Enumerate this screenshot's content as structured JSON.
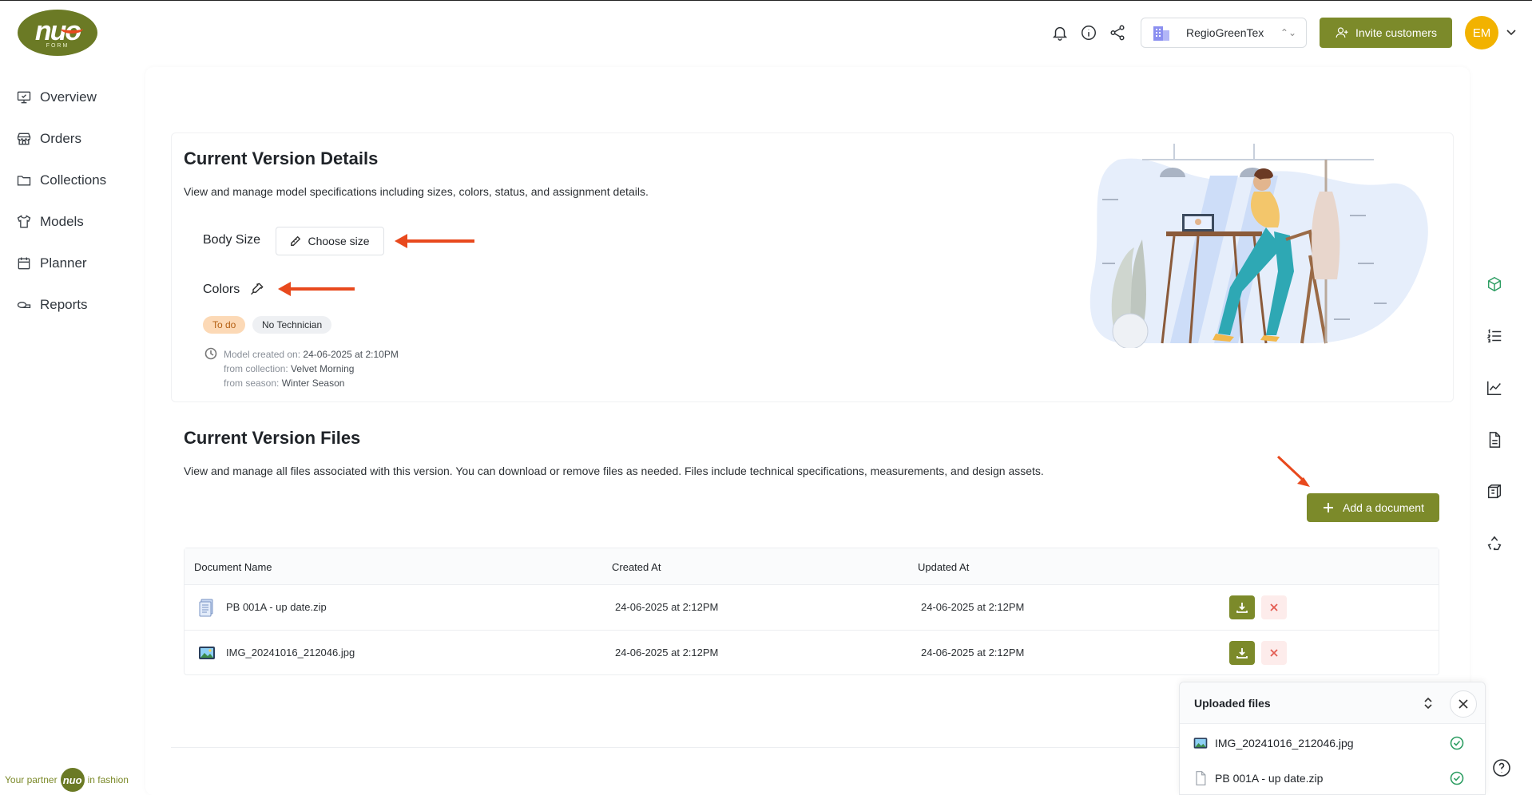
{
  "brand": {
    "logo_text": "nuo",
    "logo_sub": "FORM",
    "partner_prefix": "Your partner",
    "partner_suffix": "in fashion"
  },
  "sidebar": {
    "items": [
      {
        "label": "Overview",
        "icon": "monitor-icon"
      },
      {
        "label": "Orders",
        "icon": "store-icon"
      },
      {
        "label": "Collections",
        "icon": "folder-icon"
      },
      {
        "label": "Models",
        "icon": "shirt-icon"
      },
      {
        "label": "Planner",
        "icon": "calendar-icon"
      },
      {
        "label": "Reports",
        "icon": "tape-icon"
      }
    ]
  },
  "header": {
    "company": "RegioGreenTex",
    "invite_label": "Invite customers",
    "avatar_initials": "EM"
  },
  "details": {
    "title": "Current Version Details",
    "description": "View and manage model specifications including sizes, colors, status, and assignment details.",
    "body_size_label": "Body Size",
    "choose_size_label": "Choose size",
    "colors_label": "Colors",
    "status_badge": "To do",
    "technician_badge": "No Technician",
    "created_label": "Model created on:",
    "created_value": "24-06-2025 at 2:10PM",
    "collection_label": "from collection:",
    "collection_value": "Velvet Morning",
    "season_label": "from season:",
    "season_value": "Winter Season"
  },
  "files": {
    "title": "Current Version Files",
    "description": "View and manage all files associated with this version. You can download or remove files as needed. Files include technical specifications, measurements, and design assets.",
    "add_label": "Add a document",
    "columns": [
      "Document Name",
      "Created At",
      "Updated At"
    ],
    "rows": [
      {
        "name": "PB 001A - up date.zip",
        "created": "24-06-2025 at 2:12PM",
        "updated": "24-06-2025 at 2:12PM",
        "icon": "zip-file-icon"
      },
      {
        "name": "IMG_20241016_212046.jpg",
        "created": "24-06-2025 at 2:12PM",
        "updated": "24-06-2025 at 2:12PM",
        "icon": "image-file-icon"
      }
    ]
  },
  "uploads": {
    "title": "Uploaded files",
    "items": [
      {
        "name": "IMG_20241016_212046.jpg",
        "icon": "image-file-icon"
      },
      {
        "name": "PB 001A - up date.zip",
        "icon": "file-icon"
      }
    ]
  },
  "colors": {
    "accent": "#7c8a2a",
    "arrow": "#e8491d",
    "success": "#2e9e63",
    "avatar": "#f2b200"
  }
}
